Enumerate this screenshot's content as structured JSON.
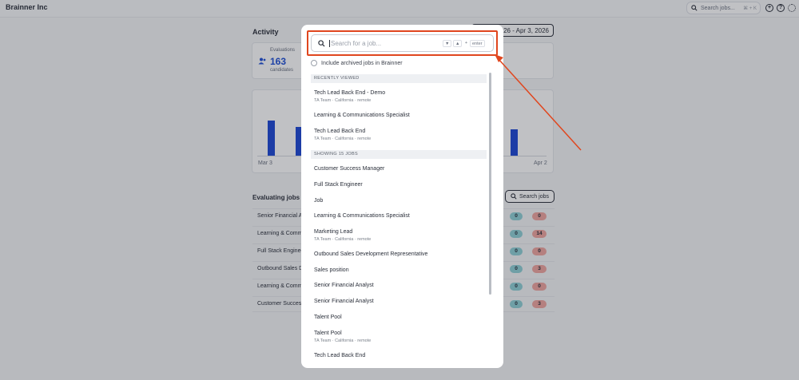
{
  "app": {
    "title": "Brainner Inc",
    "search_placeholder": "Search jobs...",
    "search_shortcut": "⌘ + K"
  },
  "dashboard": {
    "activity_title": "Activity",
    "date_range": "2026 - Apr 3, 2026",
    "stat": {
      "label": "Evaluations",
      "value": "163",
      "sub": "candidates"
    },
    "axis_start": "Mar 3",
    "axis_end": "Apr 2",
    "evaluating_title": "Evaluating jobs",
    "search_jobs_label": "Search jobs",
    "rows": [
      {
        "name": "Senior Financial A",
        "teal": "0",
        "red": "0"
      },
      {
        "name": "Learning & Comm",
        "teal": "0",
        "red": "14"
      },
      {
        "name": "Full Stack Enginee",
        "teal": "0",
        "red": "0"
      },
      {
        "name": "Outbound Sales D",
        "teal": "0",
        "red": "3"
      },
      {
        "name": "Learning & Comm",
        "teal": "0",
        "red": "0"
      },
      {
        "name": "Customer Succes",
        "teal": "0",
        "red": "3"
      }
    ]
  },
  "modal": {
    "search_placeholder": "Search for a job...",
    "key_down": "▼",
    "key_up": "▲",
    "key_plus": "+",
    "key_enter": "enter",
    "archived_label": "Include archived jobs in Brainner",
    "recent_header": "RECENTLY VIEWED",
    "recent": [
      {
        "title": "Tech Lead Back End - Demo",
        "sub": "TA Team · California · remote"
      },
      {
        "title": "Learning & Communications Specialist",
        "sub": ""
      },
      {
        "title": "Tech Lead Back End",
        "sub": "TA Team · California · remote"
      }
    ],
    "jobs_header": "SHOWING 15 JOBS",
    "jobs": [
      {
        "title": "Customer Success Manager",
        "sub": ""
      },
      {
        "title": "Full Stack Engineer",
        "sub": ""
      },
      {
        "title": "Job",
        "sub": ""
      },
      {
        "title": "Learning & Communications Specialist",
        "sub": ""
      },
      {
        "title": "Marketing Lead",
        "sub": "TA Team · California · remote"
      },
      {
        "title": "Outbound Sales Development Representative",
        "sub": ""
      },
      {
        "title": "Sales position",
        "sub": ""
      },
      {
        "title": "Senior Financial Analyst",
        "sub": ""
      },
      {
        "title": "Senior Financial Analyst",
        "sub": ""
      },
      {
        "title": "Talent Pool",
        "sub": ""
      },
      {
        "title": "Talent Pool",
        "sub": "TA Team · California · remote"
      },
      {
        "title": "Tech Lead Back End",
        "sub": ""
      }
    ]
  },
  "colors": {
    "accent": "#1c47d6",
    "highlight": "#e0461e",
    "teal": "#8fd0d6",
    "red": "#f0a6a0"
  }
}
